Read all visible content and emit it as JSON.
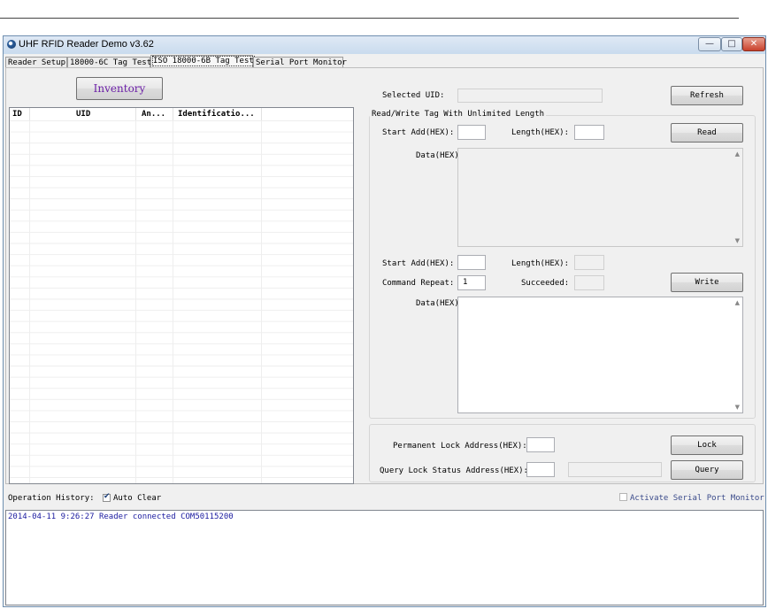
{
  "window": {
    "title": "UHF RFID Reader Demo v3.62",
    "controls": {
      "minimize": "—",
      "maximize": "□",
      "close": "✕"
    }
  },
  "tabs": [
    {
      "label": "Reader Setup",
      "active": false
    },
    {
      "label": "18000-6C Tag Test",
      "active": false
    },
    {
      "label": "ISO 18000-6B Tag Test",
      "active": true
    },
    {
      "label": "Serial Port Monitor",
      "active": false
    }
  ],
  "inventory": {
    "button_label": "Inventory",
    "columns": [
      "ID",
      "UID",
      "An...",
      "Identificatio..."
    ]
  },
  "selected_uid": {
    "label": "Selected UID:",
    "value": ""
  },
  "refresh_label": "Refresh",
  "readwrite": {
    "group_title": "Read/Write Tag With Unlimited Length",
    "read_start_label": "Start Add(HEX):",
    "read_start_value": "",
    "read_length_label": "Length(HEX):",
    "read_length_value": "",
    "read_button": "Read",
    "read_data_label": "Data(HEX):",
    "read_data_value": "",
    "write_start_label": "Start Add(HEX):",
    "write_start_value": "",
    "write_length_label": "Length(HEX):",
    "write_length_value": "",
    "command_repeat_label": "Command Repeat:",
    "command_repeat_value": "1",
    "succeeded_label": "Succeeded:",
    "succeeded_value": "",
    "write_button": "Write",
    "write_data_label": "Data(HEX):",
    "write_data_value": ""
  },
  "lock": {
    "permanent_label": "Permanent Lock Address(HEX):",
    "permanent_value": "",
    "lock_button": "Lock",
    "query_label": "Query Lock Status Address(HEX):",
    "query_value": "",
    "query_result": "",
    "query_button": "Query"
  },
  "history": {
    "label": "Operation History:",
    "auto_clear_label": "Auto Clear",
    "auto_clear_checked": true,
    "monitor_label": "Activate Serial Port Monitor",
    "monitor_checked": false,
    "entries": [
      "2014-04-11 9:26:27 Reader connected COM50115200"
    ]
  },
  "colors": {
    "accent": "#6b1fa6",
    "log_text": "#1b1ba0",
    "monitor_text": "#3a4a8a"
  }
}
